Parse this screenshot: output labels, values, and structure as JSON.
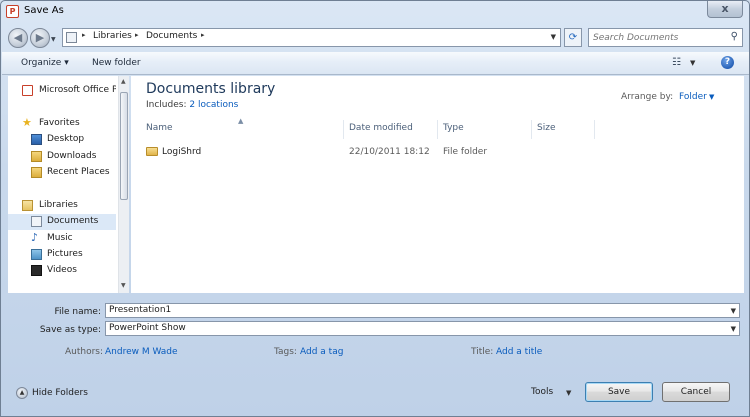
{
  "window": {
    "title": "Save As",
    "close_label": "x"
  },
  "nav": {
    "breadcrumbs": [
      "Libraries",
      "Documents"
    ],
    "search_placeholder": "Search Documents"
  },
  "toolbar": {
    "organize": "Organize",
    "new_folder": "New folder"
  },
  "sidebar": {
    "items": [
      {
        "label": "Microsoft Office Po",
        "icon": "office-icon"
      },
      {
        "label": "Favorites",
        "icon": "star-icon"
      },
      {
        "label": "Desktop",
        "icon": "desktop-icon"
      },
      {
        "label": "Downloads",
        "icon": "downloads-icon"
      },
      {
        "label": "Recent Places",
        "icon": "recent-places-icon"
      },
      {
        "label": "Libraries",
        "icon": "libraries-icon"
      },
      {
        "label": "Documents",
        "icon": "documents-icon"
      },
      {
        "label": "Music",
        "icon": "music-icon"
      },
      {
        "label": "Pictures",
        "icon": "pictures-icon"
      },
      {
        "label": "Videos",
        "icon": "videos-icon"
      }
    ]
  },
  "library": {
    "title": "Documents library",
    "includes_label": "Includes:",
    "includes_link": "2 locations",
    "arrange_label": "Arrange by:",
    "arrange_value": "Folder"
  },
  "columns": [
    "Name",
    "Date modified",
    "Type",
    "Size"
  ],
  "files": [
    {
      "name": "LogiShrd",
      "date": "22/10/2011 18:12",
      "type": "File folder",
      "size": ""
    }
  ],
  "form": {
    "file_name_label": "File name:",
    "file_name_value": "Presentation1",
    "save_type_label": "Save as type:",
    "save_type_value": "PowerPoint Show",
    "authors_label": "Authors:",
    "authors_value": "Andrew M Wade",
    "tags_label": "Tags:",
    "tags_value": "Add a tag",
    "title_label": "Title:",
    "title_value": "Add a title"
  },
  "footer": {
    "hide_folders": "Hide Folders",
    "tools": "Tools",
    "save": "Save",
    "cancel": "Cancel"
  }
}
